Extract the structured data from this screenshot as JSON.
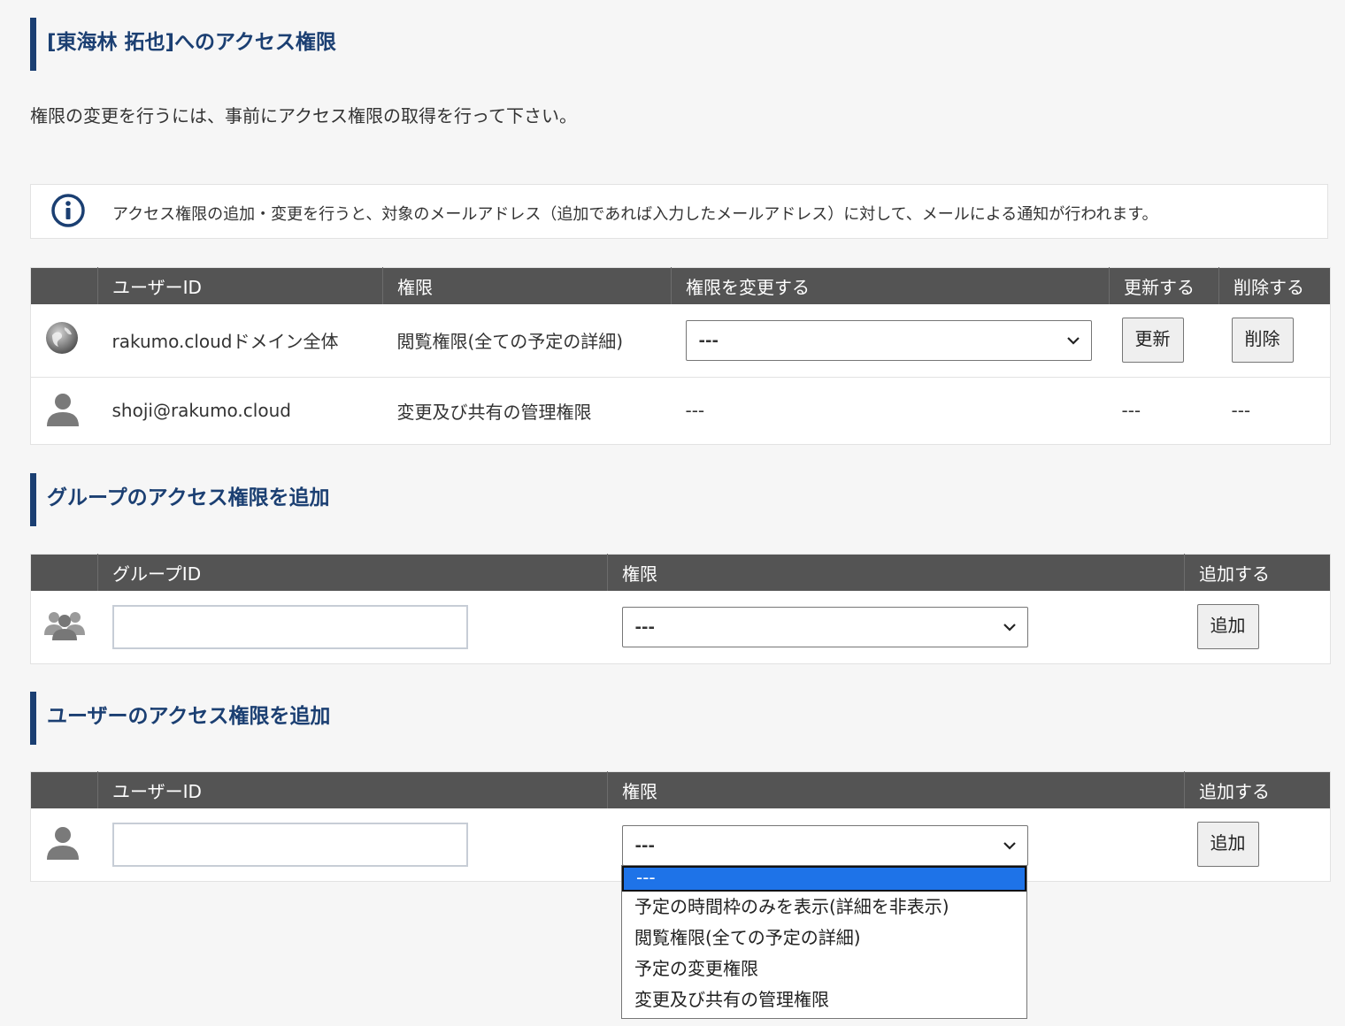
{
  "page": {
    "title": "[東海林 拓也]へのアクセス権限",
    "description": "権限の変更を行うには、事前にアクセス権限の取得を行って下さい。",
    "notice": "アクセス権限の追加・変更を行うと、対象のメールアドレス（追加であれば入力したメールアドレス）に対して、メールによる通知が行われます。"
  },
  "acl_table": {
    "headers": [
      "",
      "ユーザーID",
      "権限",
      "権限を変更する",
      "更新する",
      "削除する"
    ],
    "rows": [
      {
        "icon": "globe-icon",
        "id": "rakumo.cloudドメイン全体",
        "permission": "閲覧権限(全ての予定の詳細)",
        "change_select": "---",
        "update_label": "更新",
        "delete_label": "削除"
      },
      {
        "icon": "user-icon",
        "id": "shoji@rakumo.cloud",
        "permission": "変更及び共有の管理権限",
        "change_select": "---",
        "update_label": "---",
        "delete_label": "---"
      }
    ]
  },
  "group_section": {
    "title": "グループのアクセス権限を追加",
    "headers": [
      "",
      "グループID",
      "権限",
      "追加する"
    ],
    "id_value": "",
    "permission_select": "---",
    "add_label": "追加"
  },
  "user_section": {
    "title": "ユーザーのアクセス権限を追加",
    "headers": [
      "",
      "ユーザーID",
      "権限",
      "追加する"
    ],
    "id_value": "",
    "permission_select": "---",
    "add_label": "追加",
    "dropdown_options": [
      "---",
      "予定の時間枠のみを表示(詳細を非表示)",
      "閲覧権限(全ての予定の詳細)",
      "予定の変更権限",
      "変更及び共有の管理権限"
    ],
    "dropdown_selected_index": 0
  },
  "colors": {
    "accent": "#1b3f72",
    "header_bg": "#545454",
    "selected_option": "#1e73e8"
  }
}
